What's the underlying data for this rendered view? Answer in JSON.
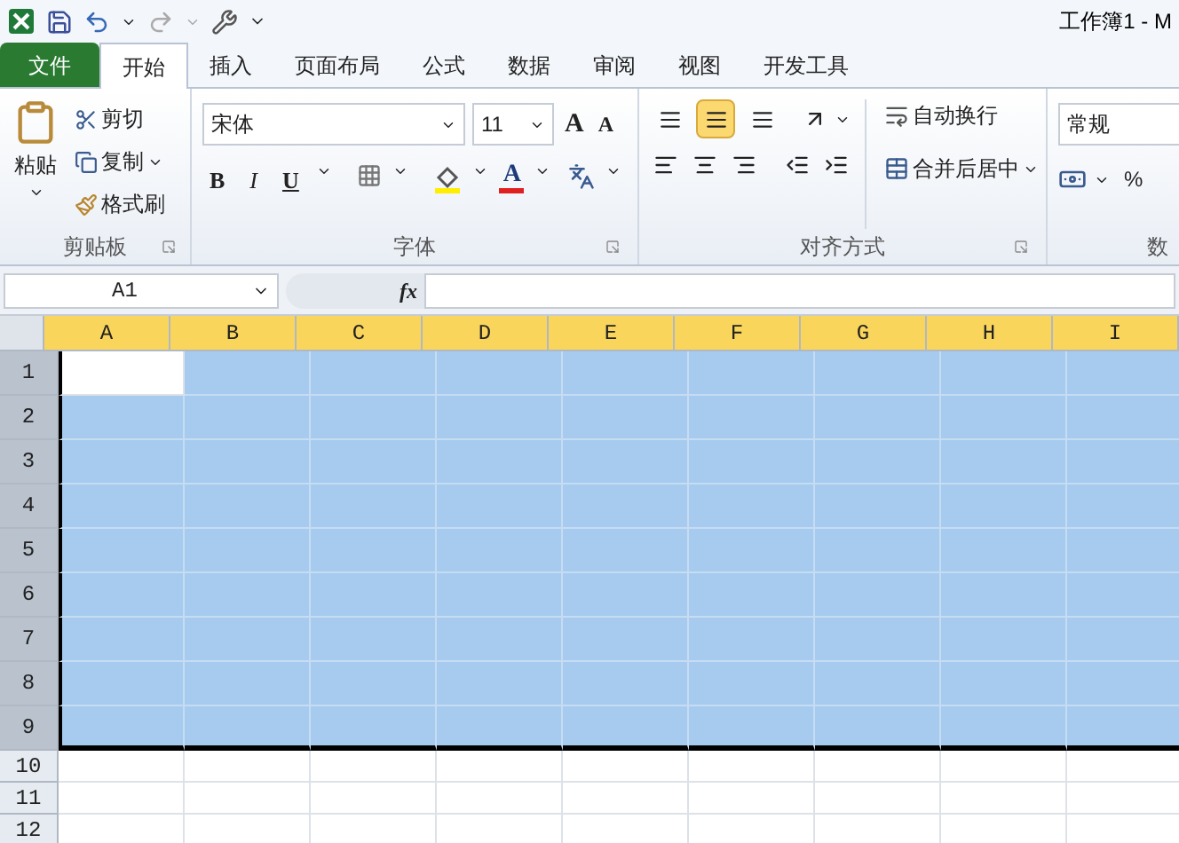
{
  "title": "工作簿1 - M",
  "tabs": [
    {
      "label": "文件",
      "kind": "file",
      "selected": false
    },
    {
      "label": "开始",
      "kind": "tab",
      "selected": true
    },
    {
      "label": "插入",
      "kind": "tab",
      "selected": false
    },
    {
      "label": "页面布局",
      "kind": "tab",
      "selected": false
    },
    {
      "label": "公式",
      "kind": "tab",
      "selected": false
    },
    {
      "label": "数据",
      "kind": "tab",
      "selected": false
    },
    {
      "label": "审阅",
      "kind": "tab",
      "selected": false
    },
    {
      "label": "视图",
      "kind": "tab",
      "selected": false
    },
    {
      "label": "开发工具",
      "kind": "tab",
      "selected": false
    }
  ],
  "clipboard": {
    "paste": "粘贴",
    "cut": "剪切",
    "copy": "复制",
    "format_painter": "格式刷",
    "group": "剪贴板"
  },
  "font": {
    "name": "宋体",
    "size": "11",
    "grow": "A",
    "shrink": "A",
    "bold": "B",
    "italic": "I",
    "underline": "U",
    "font_color": "A",
    "group": "字体"
  },
  "alignment": {
    "vertical": [
      {
        "selected": false
      },
      {
        "selected": true
      },
      {
        "selected": false
      }
    ],
    "wrap": "自动换行",
    "merge": "合并后居中",
    "group": "对齐方式"
  },
  "number": {
    "format": "常规",
    "percent": "%",
    "group": "数"
  },
  "formula_bar": {
    "name_box": "A1",
    "fx": "fx"
  },
  "columns": [
    {
      "label": "A",
      "selected": true
    },
    {
      "label": "B",
      "selected": true
    },
    {
      "label": "C",
      "selected": true
    },
    {
      "label": "D",
      "selected": true
    },
    {
      "label": "E",
      "selected": true
    },
    {
      "label": "F",
      "selected": true
    },
    {
      "label": "G",
      "selected": true
    },
    {
      "label": "H",
      "selected": true
    },
    {
      "label": "I",
      "selected": true
    }
  ],
  "rows": [
    {
      "label": "1",
      "selected": true
    },
    {
      "label": "2",
      "selected": true
    },
    {
      "label": "3",
      "selected": true
    },
    {
      "label": "4",
      "selected": true
    },
    {
      "label": "5",
      "selected": true
    },
    {
      "label": "6",
      "selected": true
    },
    {
      "label": "7",
      "selected": true
    },
    {
      "label": "8",
      "selected": true
    },
    {
      "label": "9",
      "selected": true
    },
    {
      "label": "10",
      "selected": false
    },
    {
      "label": "11",
      "selected": false
    },
    {
      "label": "12",
      "selected": false
    }
  ]
}
